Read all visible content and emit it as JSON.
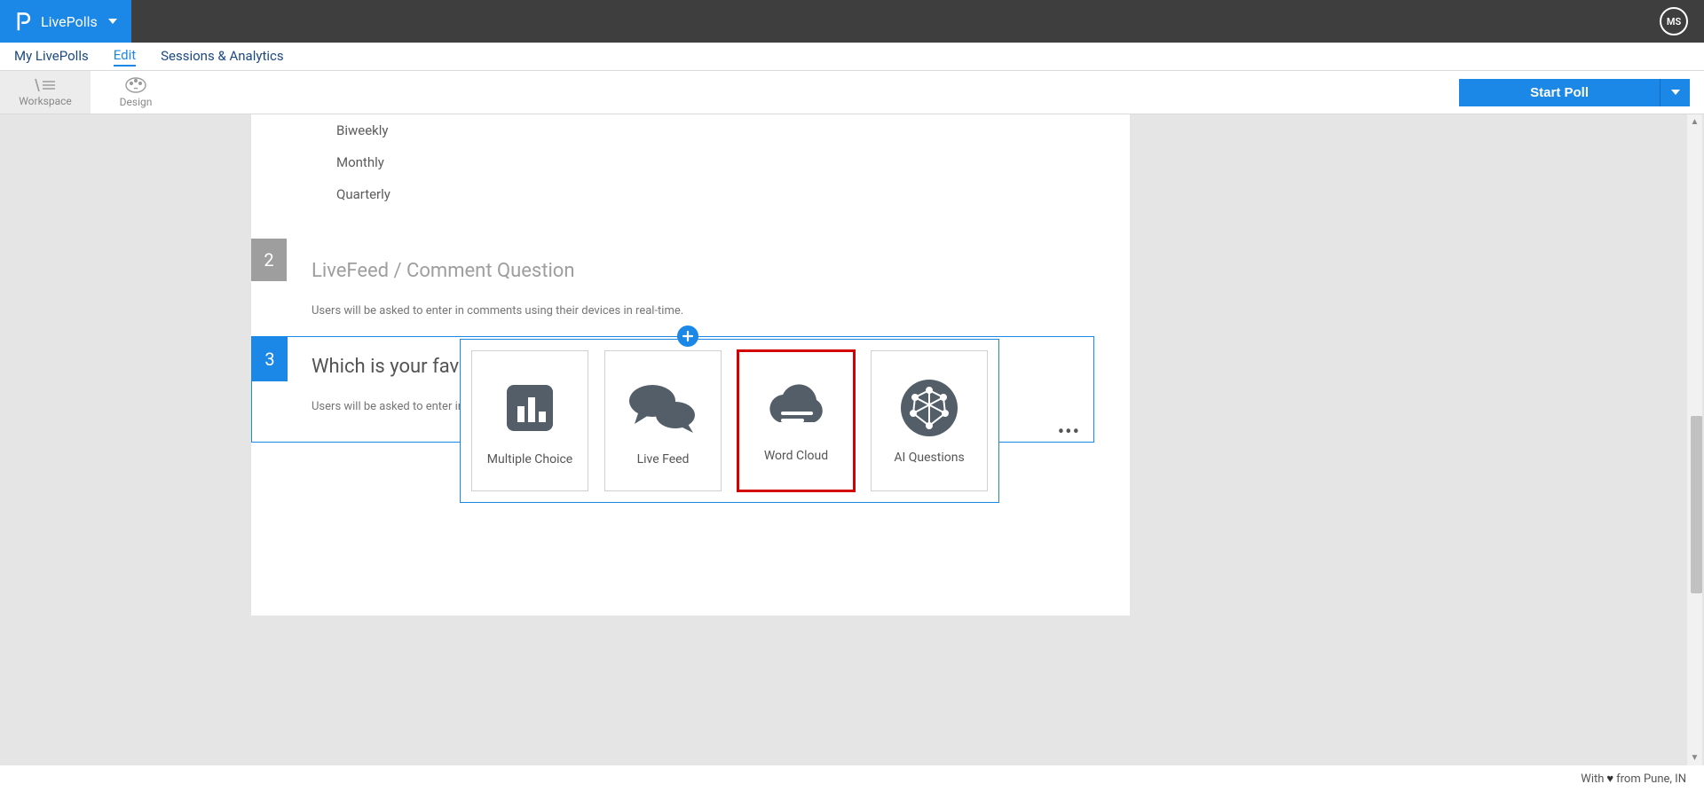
{
  "topbar": {
    "brand": "LivePolls",
    "avatar": "MS"
  },
  "subnav": {
    "my": "My LivePolls",
    "edit": "Edit",
    "sessions": "Sessions & Analytics"
  },
  "toolbar": {
    "workspace": "Workspace",
    "design": "Design",
    "start": "Start Poll"
  },
  "options": {
    "o1": "Biweekly",
    "o2": "Monthly",
    "o3": "Quarterly"
  },
  "q2": {
    "num": "2",
    "title": "LiveFeed / Comment Question",
    "desc": "Users will be asked to enter in comments using their devices in real-time."
  },
  "q3": {
    "num": "3",
    "title": "Which is your favo",
    "desc": "Users will be asked to enter in"
  },
  "picker": {
    "mc": "Multiple Choice",
    "lf": "Live Feed",
    "wc": "Word Cloud",
    "ai": "AI Questions"
  },
  "footer": {
    "prefix": "With",
    "suffix": "from Pune, IN"
  }
}
